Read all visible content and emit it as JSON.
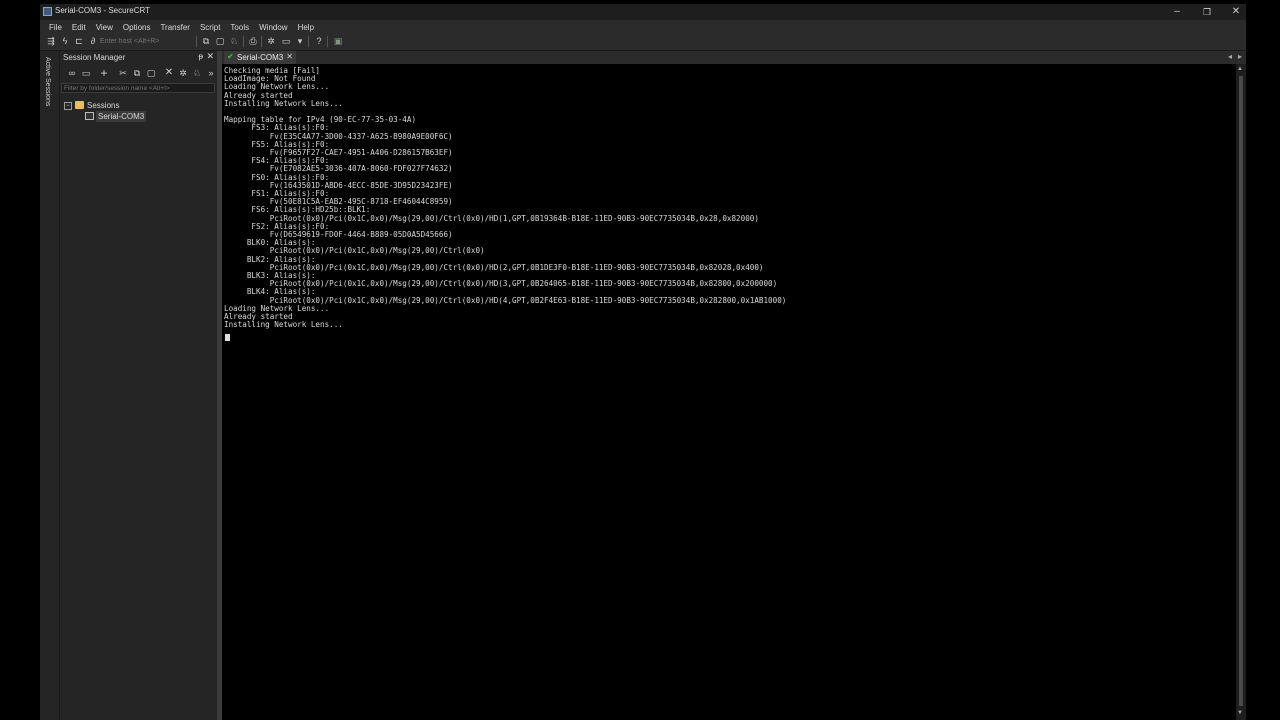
{
  "window": {
    "title": "Serial-COM3 - SecureCRT",
    "minimize": "–",
    "maximize": "❐",
    "close": "✕"
  },
  "menu": [
    "File",
    "Edit",
    "View",
    "Options",
    "Transfer",
    "Script",
    "Tools",
    "Window",
    "Help"
  ],
  "toolbar": {
    "host_placeholder": "Enter host <Alt+R>"
  },
  "side_strip": {
    "label": "Active Sessions"
  },
  "session_manager": {
    "title": "Session Manager",
    "pin": "ᵽ",
    "close": "✕",
    "filter_placeholder": "Filter by folder/session name <Alt+I>",
    "tree": {
      "folder_expander": "−",
      "folder_label": "Sessions",
      "session_label": "Serial-COM3"
    }
  },
  "tabs": [
    {
      "label": "Serial-COM3",
      "close": "✕"
    }
  ],
  "terminal": {
    "lines": [
      "Checking media [Fail]",
      "LoadImage: Not Found",
      "Loading Network Lens...",
      "Already started",
      "Installing Network Lens...",
      "",
      "Mapping table for IPv4 (90-EC-77-35-03-4A)",
      "      FS3: Alias(s):F0:",
      "          Fv(E35C4A77-3D00-4337-A625-B980A9E00F6C)",
      "      FS5: Alias(s):F0:",
      "          Fv(F9657F27-CAE7-4951-A406-D286157B63EF)",
      "      FS4: Alias(s):F0:",
      "          Fv(E7082AE5-3036-407A-8060-FDF027F74632)",
      "      FS0: Alias(s):F0:",
      "          Fv(1643501D-ABD6-4ECC-85DE-3D95D23423FE)",
      "      FS1: Alias(s):F0:",
      "          Fv(50E81C5A-EAB2-495C-8718-EF46044C8959)",
      "      FS6: Alias(s):HD25b::BLK1:",
      "          PciRoot(0x0)/Pci(0x1C,0x0)/Msg(29,00)/Ctrl(0x0)/HD(1,GPT,0B19364B-B18E-11ED-90B3-90EC7735034B,0x28,0x82000)",
      "      FS2: Alias(s):F0:",
      "          Fv(D6549619-FD0F-4464-B889-05D0A5D45666)",
      "     BLK0: Alias(s):",
      "          PciRoot(0x0)/Pci(0x1C,0x0)/Msg(29,00)/Ctrl(0x0)",
      "     BLK2: Alias(s):",
      "          PciRoot(0x0)/Pci(0x1C,0x0)/Msg(29,00)/Ctrl(0x0)/HD(2,GPT,0B1DE3F0-B18E-11ED-90B3-90EC7735034B,0x82028,0x400)",
      "     BLK3: Alias(s):",
      "          PciRoot(0x0)/Pci(0x1C,0x0)/Msg(29,00)/Ctrl(0x0)/HD(3,GPT,0B264065-B18E-11ED-90B3-90EC7735034B,0x82800,0x200000)",
      "     BLK4: Alias(s):",
      "          PciRoot(0x0)/Pci(0x1C,0x0)/Msg(29,00)/Ctrl(0x0)/HD(4,GPT,0B2F4E63-B18E-11ED-90B3-90EC7735034B,0x282800,0x1AB1000)",
      "Loading Network Lens...",
      "Already started",
      "Installing Network Lens..."
    ]
  }
}
